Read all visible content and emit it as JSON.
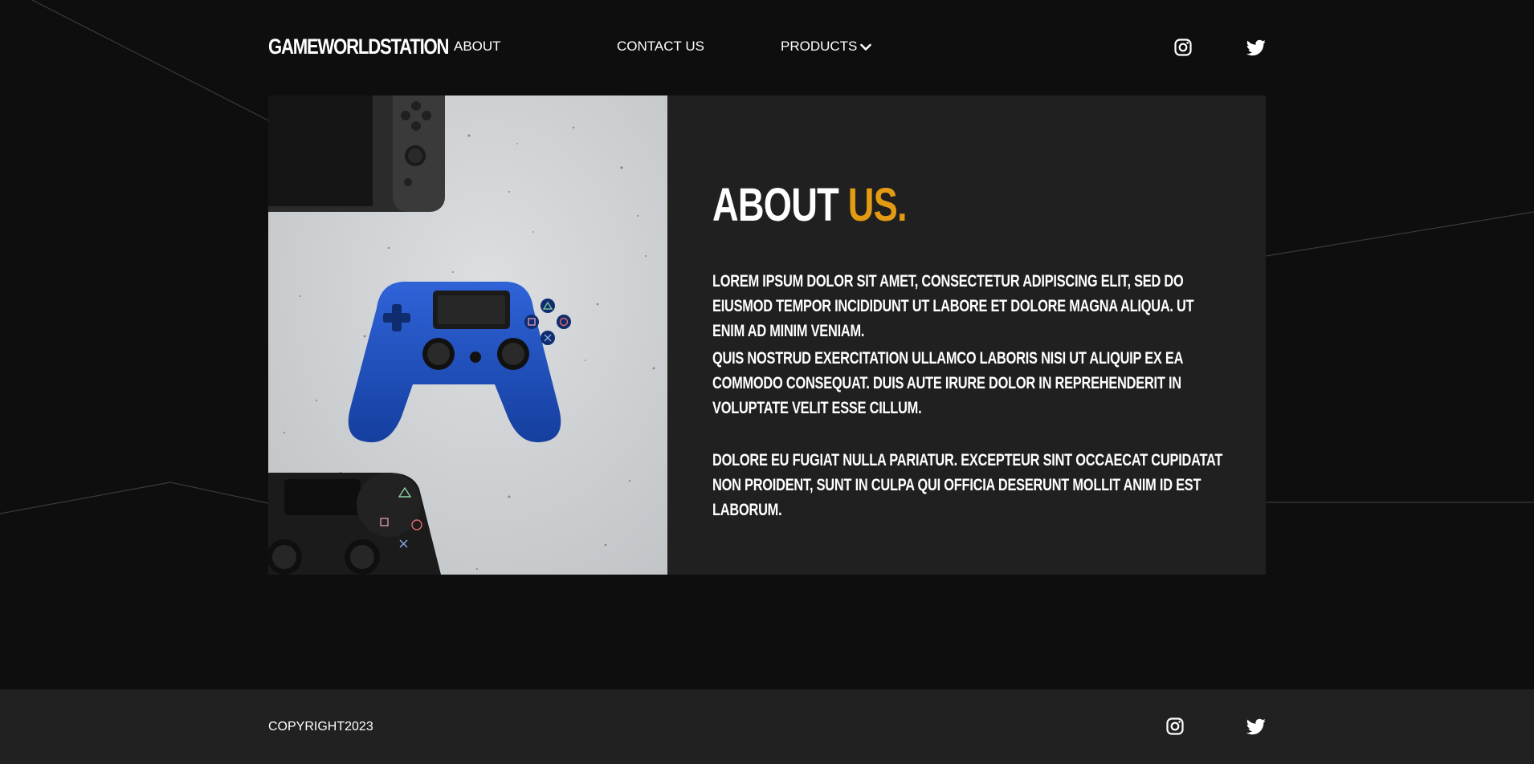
{
  "header": {
    "logo": "GAMEWORLDSTATION",
    "nav": {
      "about": "ABOUT",
      "contact": "CONTACT US",
      "products": "PRODUCTS"
    },
    "social": [
      "instagram-icon",
      "twitter-icon"
    ]
  },
  "about": {
    "title_main": "ABOUT ",
    "title_accent": "US.",
    "paragraphs": [
      "LOREM IPSUM DOLOR SIT AMET, CONSECTETUR ADIPISCING ELIT, SED DO EIUSMOD TEMPOR INCIDIDUNT UT LABORE ET DOLORE MAGNA ALIQUA. UT ENIM AD MINIM VENIAM.",
      "QUIS NOSTRUD EXERCITATION ULLAMCO LABORIS NISI UT ALIQUIP EX EA COMMODO CONSEQUAT. DUIS AUTE IRURE DOLOR IN REPREHENDERIT IN VOLUPTATE VELIT ESSE CILLUM.",
      "DOLORE EU FUGIAT NULLA PARIATUR. EXCEPTEUR SINT OCCAECAT CUPIDATAT NON PROIDENT, SUNT IN CULPA QUI OFFICIA DESERUNT MOLLIT ANIM ID EST LABORUM."
    ]
  },
  "footer": {
    "copyright": "COPYRIGHT2023"
  },
  "colors": {
    "background": "#0e0e0e",
    "panel": "#202020",
    "footer": "#212121",
    "accent": "#e29b12",
    "text": "#ffffff"
  }
}
